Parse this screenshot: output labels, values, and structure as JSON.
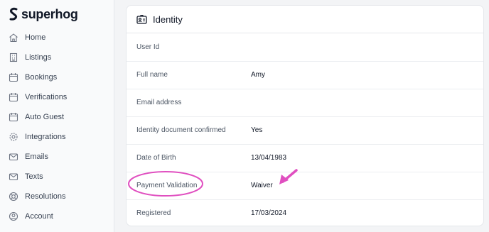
{
  "brand": {
    "name": "superhog"
  },
  "sidebar": {
    "items": [
      {
        "label": "Home",
        "icon": "home-icon"
      },
      {
        "label": "Listings",
        "icon": "building-icon"
      },
      {
        "label": "Bookings",
        "icon": "calendar-icon"
      },
      {
        "label": "Verifications",
        "icon": "calendar-icon"
      },
      {
        "label": "Auto Guest",
        "icon": "calendar-icon"
      },
      {
        "label": "Integrations",
        "icon": "gear-icon"
      },
      {
        "label": "Emails",
        "icon": "mail-icon"
      },
      {
        "label": "Texts",
        "icon": "mail-icon"
      },
      {
        "label": "Resolutions",
        "icon": "lifebuoy-icon"
      },
      {
        "label": "Account",
        "icon": "user-circle-icon"
      }
    ]
  },
  "identity": {
    "title": "Identity",
    "icon": "id-card-icon",
    "rows": [
      {
        "label": "User Id",
        "value": ""
      },
      {
        "label": "Full name",
        "value": "Amy"
      },
      {
        "label": "Email address",
        "value": ""
      },
      {
        "label": "Identity document confirmed",
        "value": "Yes"
      },
      {
        "label": "Date of Birth",
        "value": "13/04/1983"
      },
      {
        "label": "Payment Validation",
        "value": "Waiver"
      },
      {
        "label": "Registered",
        "value": "17/03/2024"
      }
    ]
  },
  "annotation": {
    "color": "#e04fc0"
  }
}
